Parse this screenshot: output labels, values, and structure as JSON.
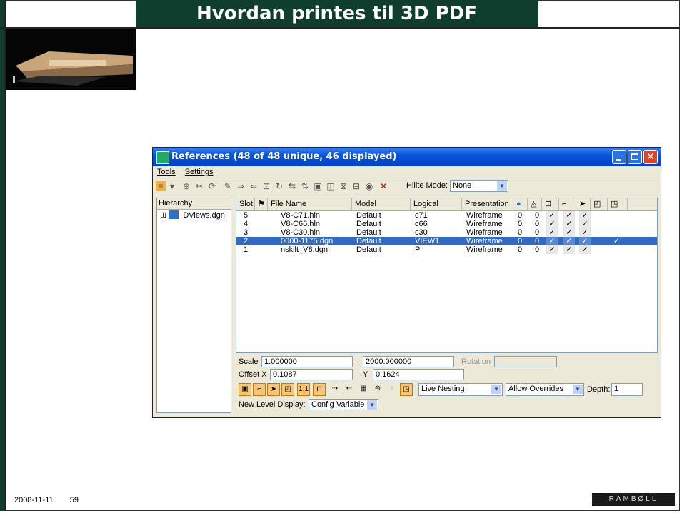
{
  "slide": {
    "title": "Hvordan printes til 3D PDF",
    "footer_date": "2008-11-11",
    "footer_page": "59",
    "logo_text": "RAMBØLL"
  },
  "window": {
    "title": "References (48 of 48 unique, 46 displayed)",
    "menus": [
      "Tools",
      "Settings"
    ],
    "hilite_label": "Hilite Mode:",
    "hilite_value": "None"
  },
  "hierarchy": {
    "header": "Hierarchy",
    "root": "DViews.dgn"
  },
  "table": {
    "columns": [
      "Slot",
      "File Name",
      "Model",
      "Logical",
      "Presentation"
    ],
    "rows": [
      {
        "slot": "5",
        "file": "V8-C71.hln",
        "model": "Default",
        "logical": "c71",
        "presentation": "Wireframe",
        "a": "0",
        "b": "0",
        "c1": "✓",
        "c2": "✓",
        "c3": "✓",
        "c4": "",
        "selected": false
      },
      {
        "slot": "4",
        "file": "V8-C66.hln",
        "model": "Default",
        "logical": "c66",
        "presentation": "Wireframe",
        "a": "0",
        "b": "0",
        "c1": "✓",
        "c2": "✓",
        "c3": "✓",
        "c4": "",
        "selected": false
      },
      {
        "slot": "3",
        "file": "V8-C30.hln",
        "model": "Default",
        "logical": "c30",
        "presentation": "Wireframe",
        "a": "0",
        "b": "0",
        "c1": "✓",
        "c2": "✓",
        "c3": "✓",
        "c4": "",
        "selected": false
      },
      {
        "slot": "2",
        "file": "0000-1175.dgn",
        "model": "Default",
        "logical": "VIEW1",
        "presentation": "Wireframe",
        "a": "0",
        "b": "0",
        "c1": "✓",
        "c2": "✓",
        "c3": "✓",
        "c4": "✓",
        "selected": true
      },
      {
        "slot": "1",
        "file": "nskilt_V8.dgn",
        "model": "Default",
        "logical": "P",
        "presentation": "Wireframe",
        "a": "0",
        "b": "0",
        "c1": "✓",
        "c2": "✓",
        "c3": "✓",
        "c4": "",
        "selected": false
      }
    ]
  },
  "settings": {
    "scale_label": "Scale",
    "scale_value": "1.000000",
    "scale_sep": ":",
    "scale_value2": "2000.000000",
    "rotation_label": "Rotation",
    "offset_x_label": "Offset X",
    "offset_x_value": "0.1087",
    "offset_y_label": "Y",
    "offset_y_value": "0.1624",
    "nesting_value": "Live Nesting",
    "overrides_value": "Allow Overrides",
    "depth_label": "Depth:",
    "depth_value": "1",
    "level_display_label": "New Level Display:",
    "level_display_value": "Config Variable"
  },
  "icons": [
    "window-app-icon",
    "minimize-icon",
    "maximize-icon",
    "close-icon",
    "tool-icon",
    "attach-icon",
    "detach-icon",
    "reload-icon",
    "check-icon"
  ]
}
